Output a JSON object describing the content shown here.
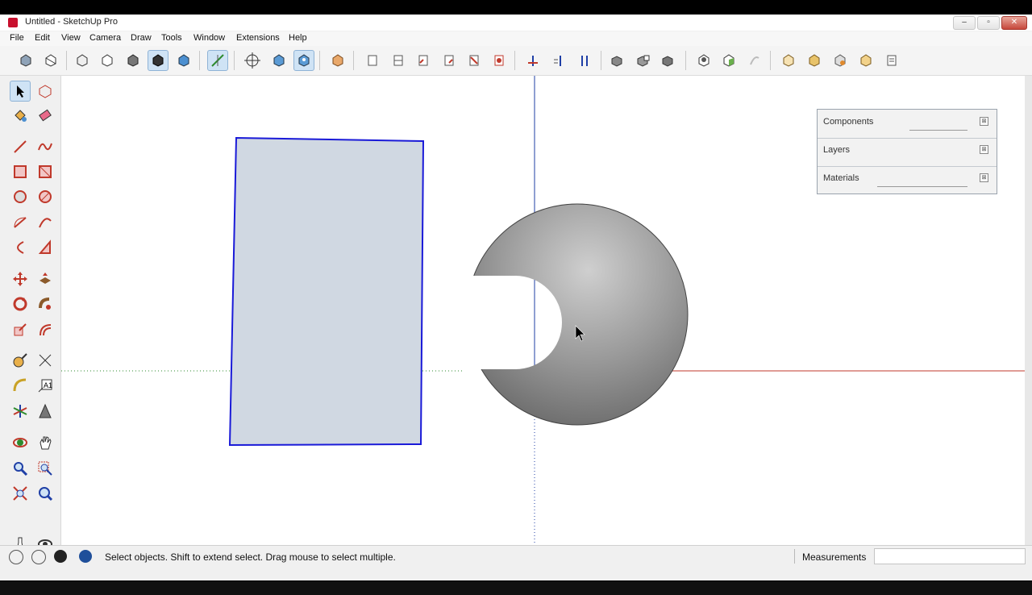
{
  "window": {
    "title": "Untitled - SketchUp Pro",
    "controls": {
      "minimize": "–",
      "maximize": "▫",
      "close": "✕"
    }
  },
  "menubar": {
    "items": [
      "File",
      "Edit",
      "View",
      "Camera",
      "Draw",
      "Tools",
      "Window",
      "Extensions",
      "Help"
    ]
  },
  "toolbar": {
    "buttons": [
      "getting-started-icon",
      "sandbox-icon",
      "xray-icon",
      "back-edges-icon",
      "wireframe-icon",
      "hidden-line-icon",
      "shaded-icon",
      "shaded-textures-icon",
      "monochrome-icon",
      "axes-icon",
      "position-camera-icon",
      "iso-view-icon",
      "top-view-icon",
      "front-view-icon",
      "right-view-icon",
      "back-view-icon",
      "left-view-icon",
      "bottom-view-icon",
      "section-plane-icon",
      "section-display-icon",
      "section-cut-icon",
      "outer-shell-icon",
      "intersect-icon",
      "union-icon",
      "subtract-icon",
      "trim-icon",
      "split-icon",
      "warehouse-icon",
      "share-model-icon",
      "share-component-icon",
      "extension-warehouse-icon",
      "layout-icon"
    ]
  },
  "tray": {
    "panels": [
      {
        "label": "Components"
      },
      {
        "label": "Layers"
      },
      {
        "label": "Materials"
      }
    ],
    "close_glyph": "⊠"
  },
  "status": {
    "hint": "Select objects. Shift to extend select. Drag mouse to select multiple.",
    "measurements_label": "Measurements",
    "measurements_value": ""
  },
  "colors": {
    "accent": "#cfe3f5",
    "selection_edge": "#1a1ad8",
    "face": "#d0d8e2",
    "red_axis": "#c0392b",
    "green_axis": "#2e8b2e",
    "blue_axis": "#1f3fa6"
  }
}
